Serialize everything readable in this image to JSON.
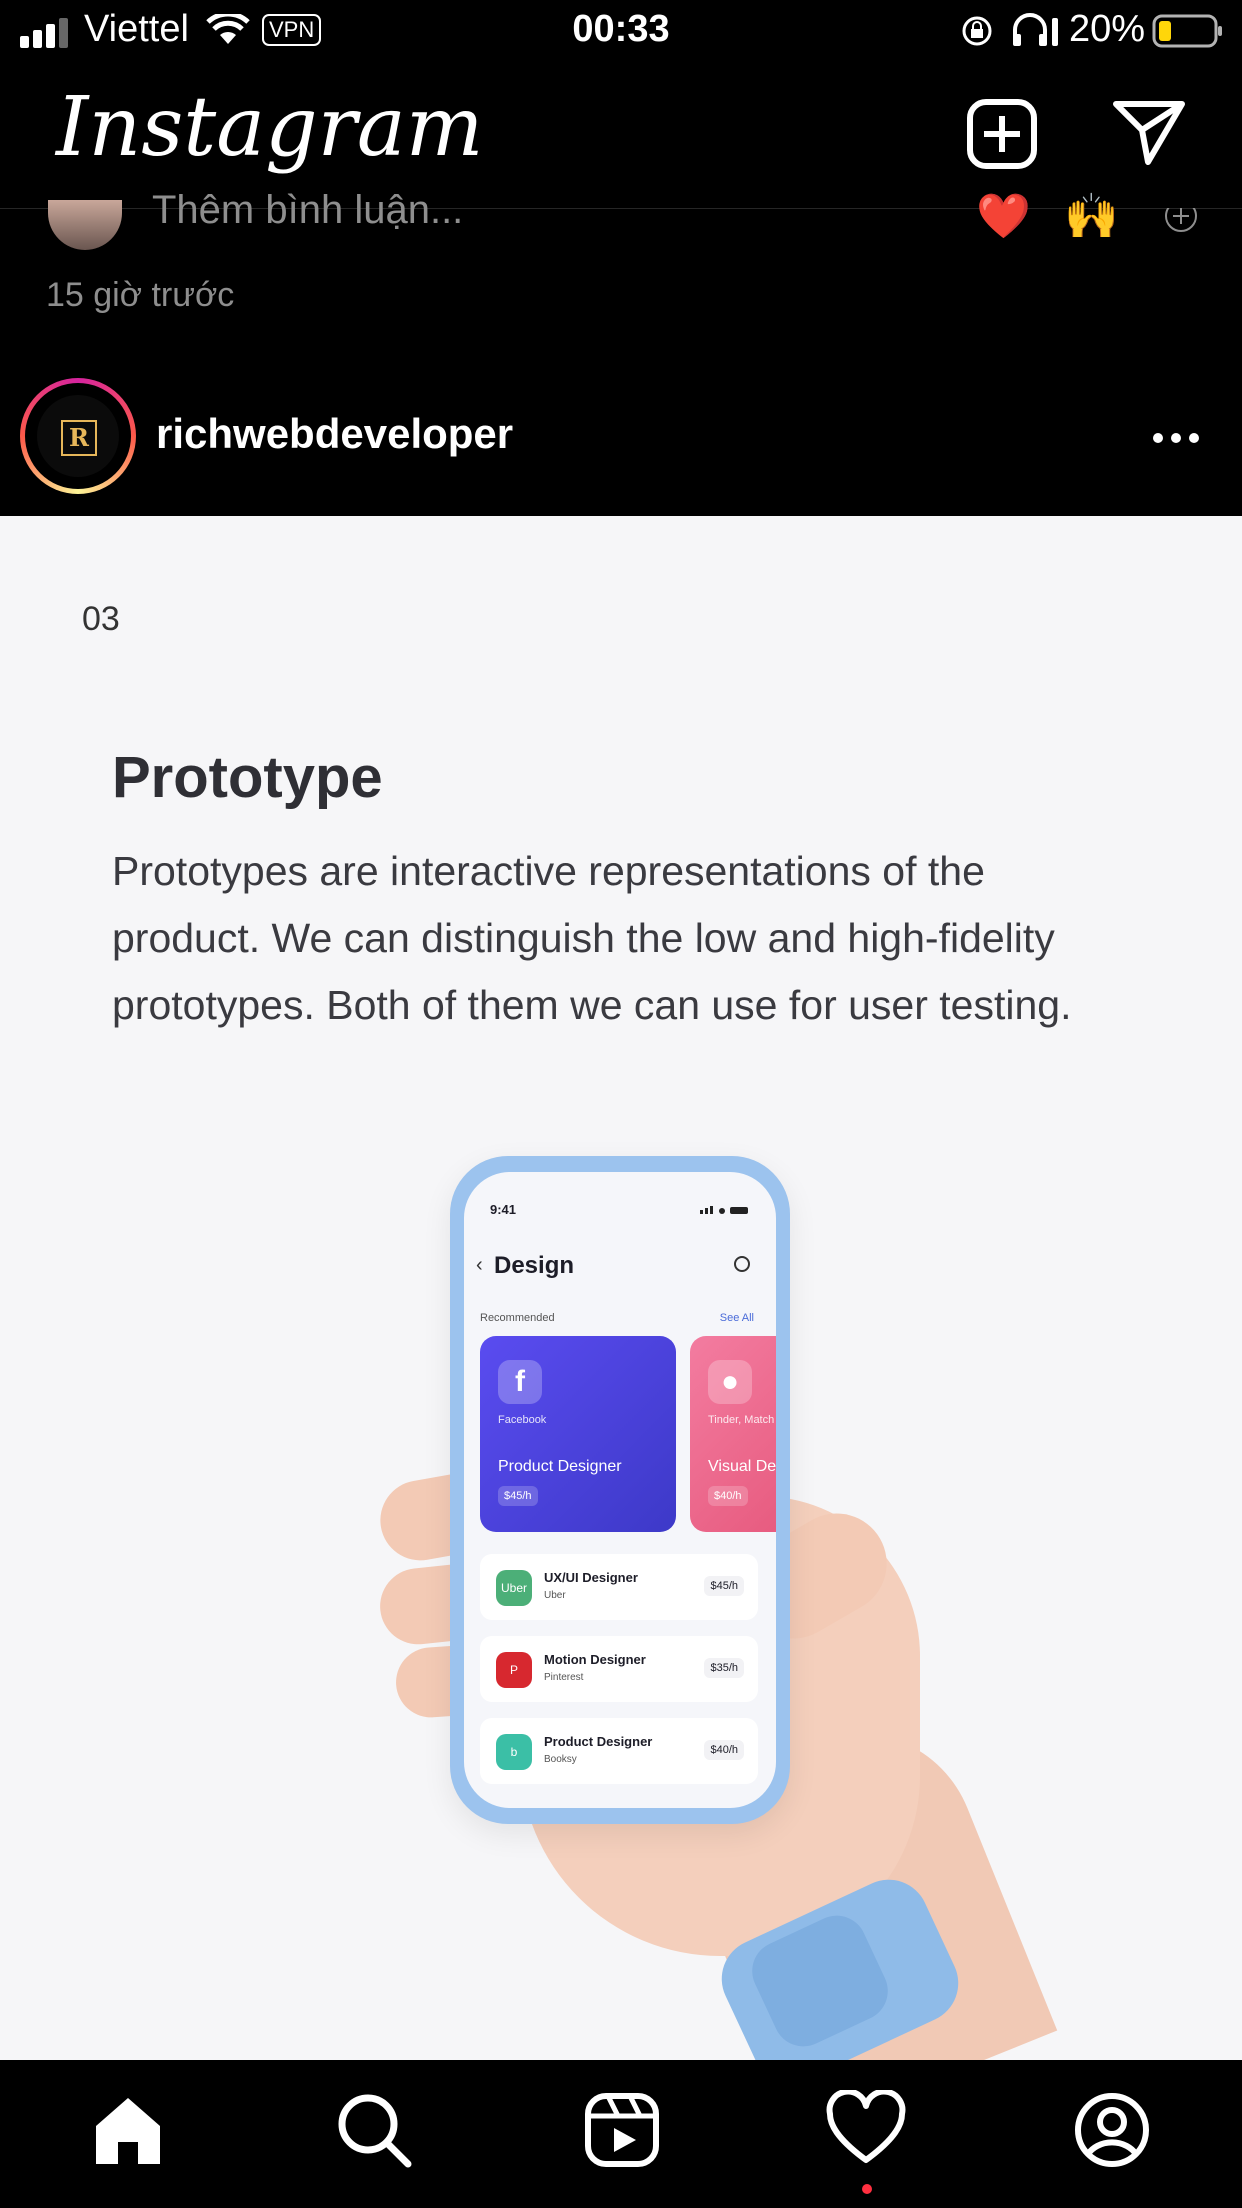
{
  "status_bar": {
    "carrier": "Viettel",
    "vpn": "VPN",
    "time": "00:33",
    "battery": "20%"
  },
  "header": {
    "logo": "Instagram",
    "icons": [
      "new-post-icon",
      "direct-message-icon"
    ]
  },
  "previous_post": {
    "comment_placeholder": "Thêm bình luận...",
    "timestamp": "15 giờ trước",
    "quick_reactions": [
      "❤️",
      "🙌"
    ]
  },
  "post": {
    "username": "richwebdeveloper",
    "avatar_letter": "R",
    "slide": {
      "number": "03",
      "title": "Prototype",
      "description": "Prototypes are interactive representations of the product. We can distinguish the low and high-fidelity prototypes. Both of them we can use for user testing."
    },
    "mockup": {
      "time": "9:41",
      "title": "Design",
      "recommended": "Recommended",
      "see_all": "See All",
      "cards": [
        {
          "icon": "f",
          "company": "Facebook",
          "role": "Product Designer",
          "price": "$45/h"
        },
        {
          "icon": "●",
          "company": "Tinder, Match",
          "role": "Visual De",
          "price": "$40/h"
        }
      ],
      "jobs": [
        {
          "icon": "Uber",
          "role": "UX/UI Designer",
          "company": "Uber",
          "price": "$45/h",
          "color": "#4caf78"
        },
        {
          "icon": "P",
          "role": "Motion Designer",
          "company": "Pinterest",
          "price": "$35/h",
          "color": "#d7282f"
        },
        {
          "icon": "b",
          "role": "Product Designer",
          "company": "Booksy",
          "price": "$40/h",
          "color": "#3bbfa6"
        }
      ]
    }
  },
  "tab_bar": {
    "icons": [
      "home-icon",
      "search-icon",
      "reels-icon",
      "activity-heart-icon",
      "profile-icon"
    ]
  },
  "colors": {
    "background": "#000000",
    "post_background": "#f6f6f8",
    "notification_dot": "#ff3040"
  }
}
